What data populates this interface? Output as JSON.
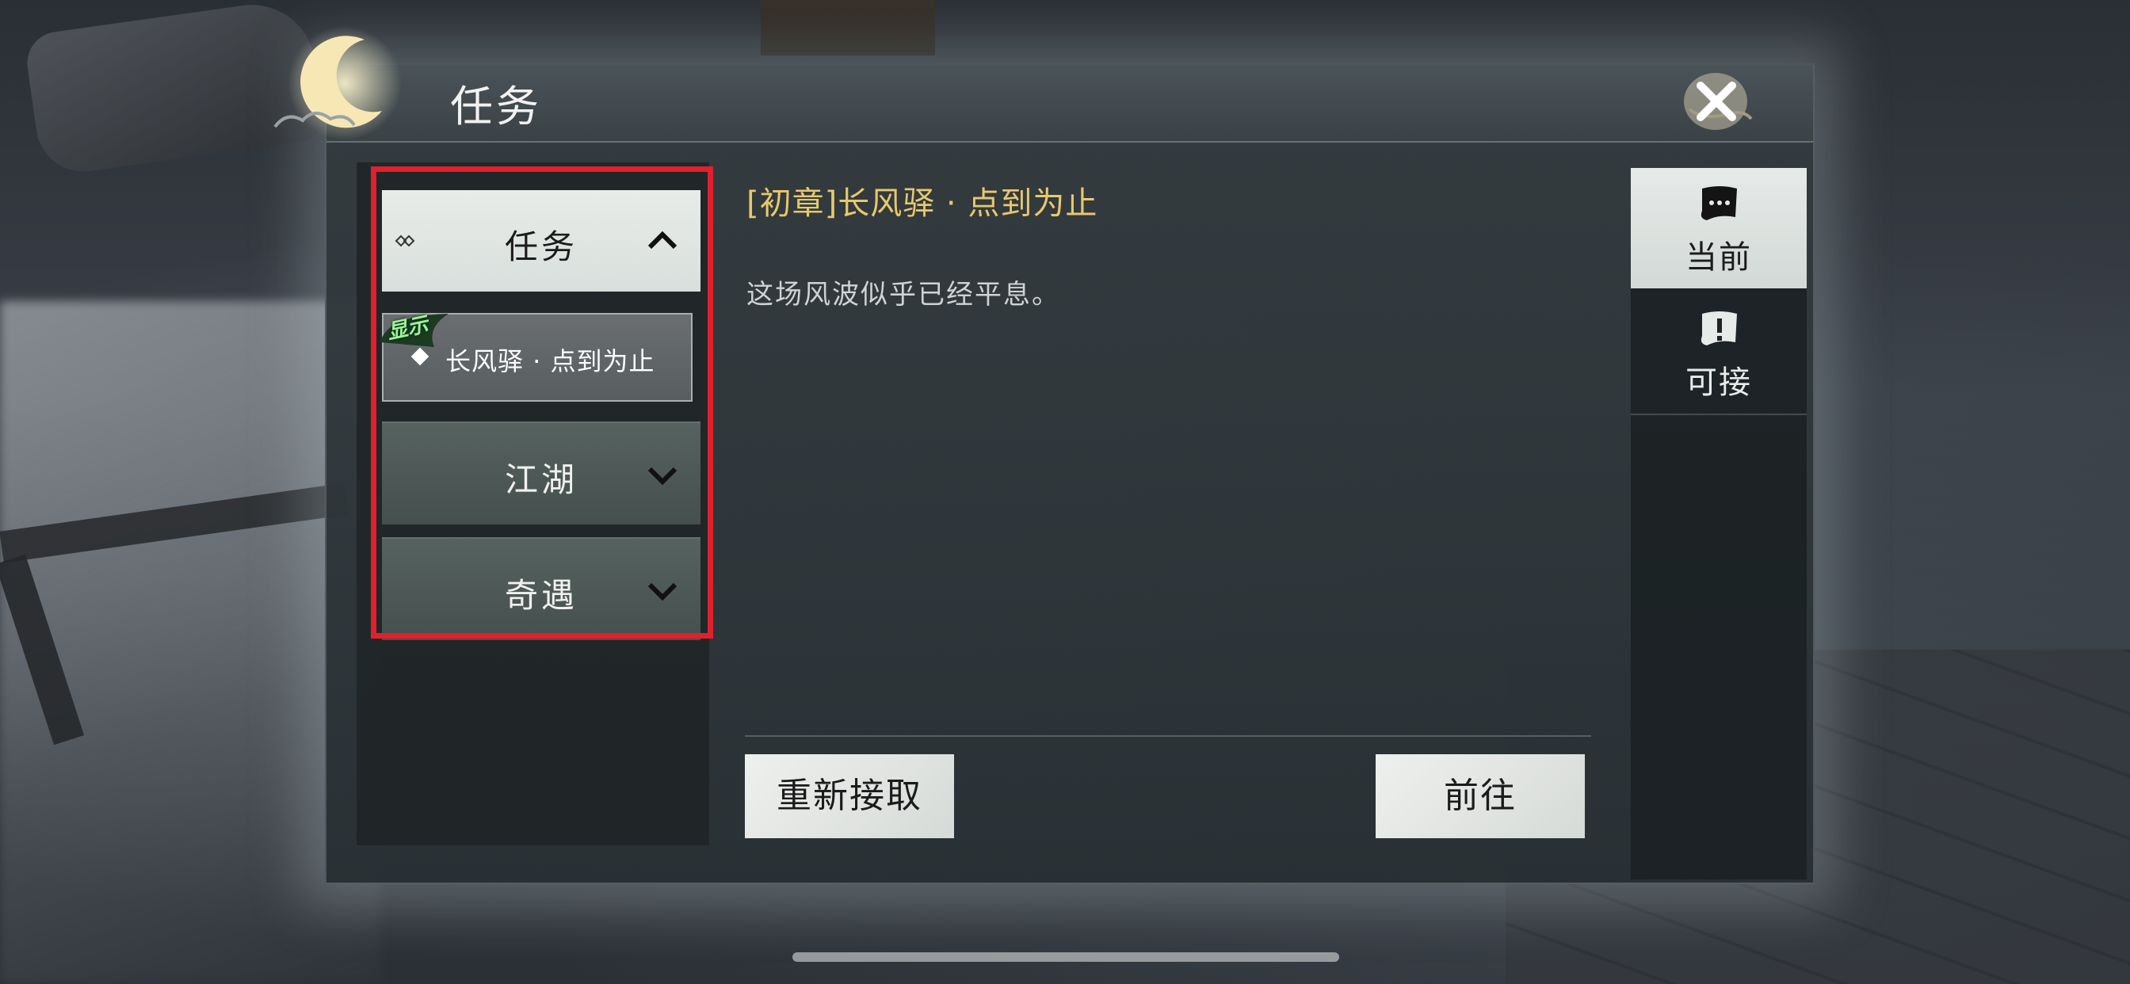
{
  "header": {
    "title": "任务",
    "close_icon": "close-x-icon"
  },
  "categories": [
    {
      "label": "任务",
      "state": "expanded",
      "chevron": "chevron-up-icon"
    },
    {
      "label": "江湖",
      "state": "collapsed",
      "chevron": "chevron-down-icon"
    },
    {
      "label": "奇遇",
      "state": "collapsed",
      "chevron": "chevron-down-icon"
    }
  ],
  "quest_item": {
    "tag": "显示",
    "label": "长风驿 · 点到为止"
  },
  "detail": {
    "title": "[初章]长风驿 · 点到为止",
    "description": "这场风波似乎已经平息。"
  },
  "buttons": {
    "reaccept": "重新接取",
    "goto": "前往"
  },
  "tabs": [
    {
      "label": "当前",
      "icon": "scroll-chat-icon",
      "selected": true
    },
    {
      "label": "可接",
      "icon": "scroll-exclaim-icon",
      "selected": false
    }
  ],
  "colors": {
    "title_gold": "#e8c86c",
    "highlight_red": "#e0202c",
    "tag_green": "#9bf59b"
  }
}
